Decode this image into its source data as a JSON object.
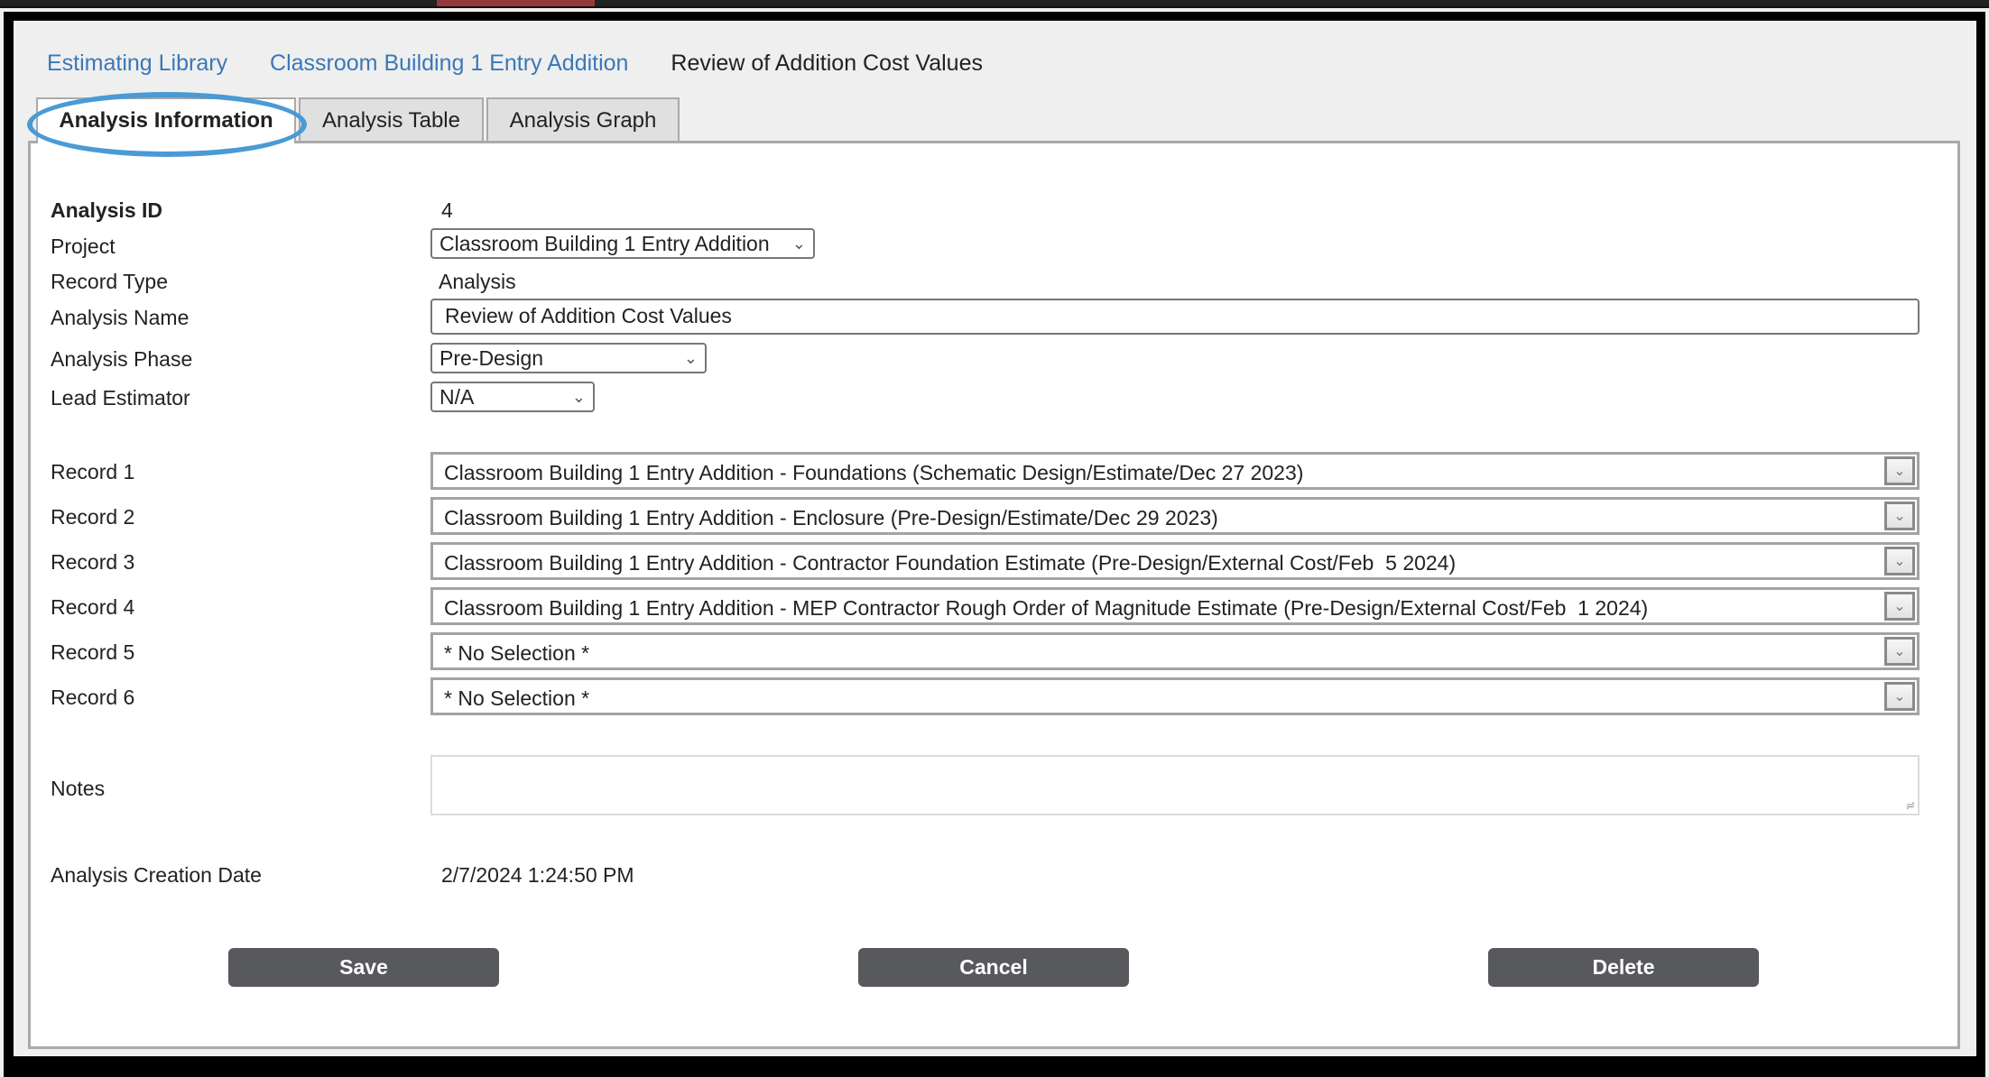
{
  "breadcrumb": [
    {
      "label": "Estimating Library",
      "link": true
    },
    {
      "label": "Classroom Building 1 Entry Addition",
      "link": true
    },
    {
      "label": "Review of Addition Cost Values",
      "link": false
    }
  ],
  "tabs": [
    {
      "label": "Analysis Information",
      "active": true
    },
    {
      "label": "Analysis Table",
      "active": false
    },
    {
      "label": "Analysis Graph",
      "active": false
    }
  ],
  "highlight": {
    "color": "#4a9ad6",
    "target": "Analysis Information"
  },
  "form": {
    "analysis_id": {
      "label": "Analysis ID",
      "value": "4"
    },
    "project": {
      "label": "Project",
      "value": "Classroom Building 1 Entry Addition"
    },
    "record_type": {
      "label": "Record Type",
      "value": "Analysis"
    },
    "analysis_name": {
      "label": "Analysis Name",
      "value": "Review of Addition Cost Values"
    },
    "analysis_phase": {
      "label": "Analysis Phase",
      "value": "Pre-Design"
    },
    "lead_estimator": {
      "label": "Lead Estimator",
      "value": "N/A"
    },
    "records": [
      {
        "label": "Record 1",
        "value": "Classroom Building 1 Entry Addition - Foundations (Schematic Design/Estimate/Dec 27 2023)"
      },
      {
        "label": "Record 2",
        "value": "Classroom Building 1 Entry Addition - Enclosure (Pre-Design/Estimate/Dec 29 2023)"
      },
      {
        "label": "Record 3",
        "value": "Classroom Building 1 Entry Addition - Contractor Foundation Estimate (Pre-Design/External Cost/Feb  5 2024)"
      },
      {
        "label": "Record 4",
        "value": "Classroom Building 1 Entry Addition - MEP Contractor Rough Order of Magnitude Estimate (Pre-Design/External Cost/Feb  1 2024)"
      },
      {
        "label": "Record 5",
        "value": "* No Selection *"
      },
      {
        "label": "Record 6",
        "value": "* No Selection *"
      }
    ],
    "notes": {
      "label": "Notes",
      "value": ""
    },
    "creation_date": {
      "label": "Analysis Creation Date",
      "value": "2/7/2024 1:24:50 PM"
    }
  },
  "buttons": {
    "save": "Save",
    "cancel": "Cancel",
    "delete": "Delete"
  },
  "colors": {
    "link": "#3a78b8",
    "button_bg": "#58595c",
    "accent_bar": "#943a3a"
  }
}
